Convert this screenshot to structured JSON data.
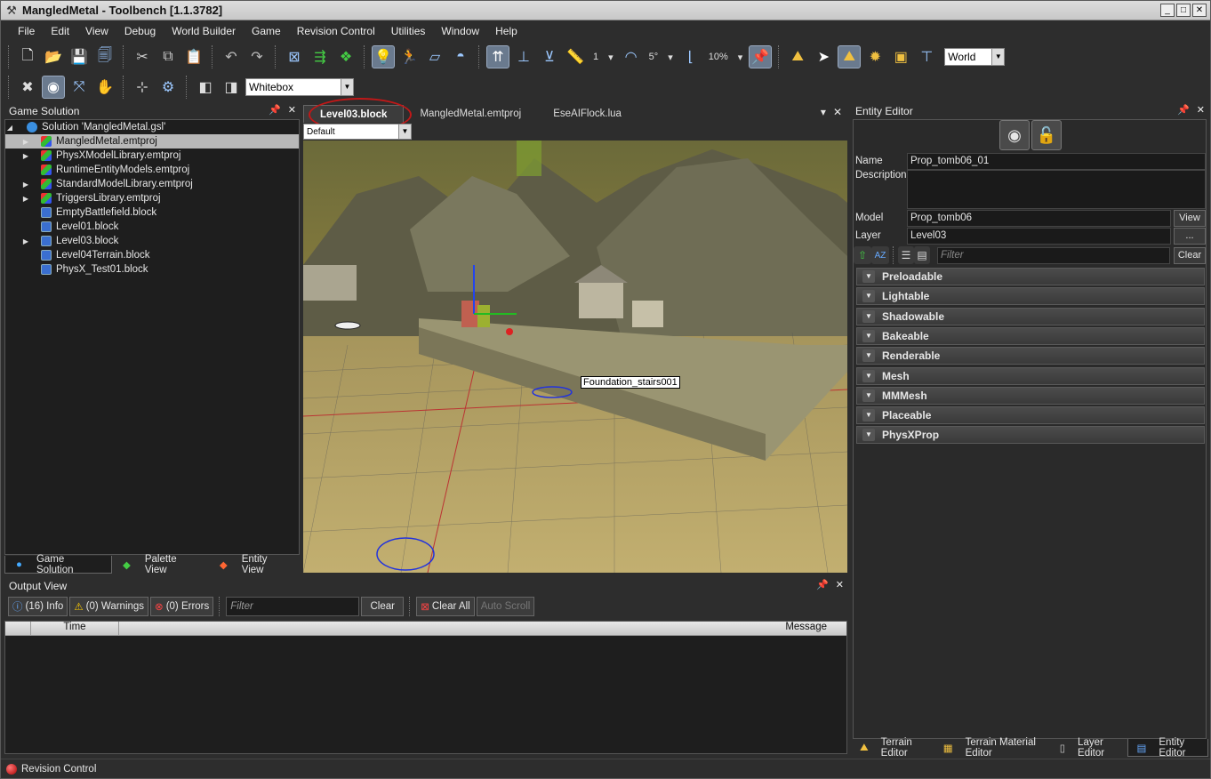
{
  "window": {
    "title": "MangledMetal - Toolbench [1.1.3782]"
  },
  "menu": [
    "File",
    "Edit",
    "View",
    "Debug",
    "World Builder",
    "Game",
    "Revision Control",
    "Utilities",
    "Window",
    "Help"
  ],
  "toolbar": {
    "snap_count": "1",
    "angle": "5°",
    "scale": "10%",
    "coord_space": "World",
    "render_mode": "Whitebox"
  },
  "solution": {
    "title": "Game Solution",
    "root": "Solution 'MangledMetal.gsl'",
    "items": [
      {
        "label": "MangledMetal.emtproj",
        "kind": "proj",
        "exp": true,
        "sel": true
      },
      {
        "label": "PhysXModelLibrary.emtproj",
        "kind": "proj",
        "exp": true
      },
      {
        "label": "RuntimeEntityModels.emtproj",
        "kind": "proj",
        "exp": false
      },
      {
        "label": "StandardModelLibrary.emtproj",
        "kind": "proj",
        "exp": true
      },
      {
        "label": "TriggersLibrary.emtproj",
        "kind": "proj",
        "exp": true
      },
      {
        "label": "EmptyBattlefield.block",
        "kind": "blk",
        "exp": false
      },
      {
        "label": "Level01.block",
        "kind": "blk",
        "exp": false
      },
      {
        "label": "Level03.block",
        "kind": "blk",
        "exp": true
      },
      {
        "label": "Level04Terrain.block",
        "kind": "blk",
        "exp": false
      },
      {
        "label": "PhysX_Test01.block",
        "kind": "blk",
        "exp": false
      }
    ],
    "tabs": [
      "Game Solution",
      "Palette View",
      "Entity View"
    ]
  },
  "doc": {
    "tabs": [
      "Level03.block",
      "MangledMetal.emtproj",
      "EseAIFlock.lua"
    ],
    "view_combo": "Default",
    "tooltip": "Foundation_stairs001"
  },
  "entity": {
    "title": "Entity Editor",
    "name_label": "Name",
    "name": "Prop_tomb06_01",
    "desc_label": "Description",
    "model_label": "Model",
    "model": "Prop_tomb06",
    "view_btn": "View",
    "layer_label": "Layer",
    "layer": "Level03",
    "more_btn": "...",
    "filter_placeholder": "Filter",
    "clear_btn": "Clear",
    "categories": [
      "Preloadable",
      "Lightable",
      "Shadowable",
      "Bakeable",
      "Renderable",
      "Mesh",
      "MMMesh",
      "Placeable",
      "PhysXProp"
    ],
    "tabs": [
      "Terrain Editor",
      "Terrain Material Editor",
      "Layer Editor",
      "Entity Editor"
    ]
  },
  "output": {
    "title": "Output View",
    "info": "(16) Info",
    "warnings": "(0) Warnings",
    "errors": "(0) Errors",
    "filter": "Filter",
    "clear": "Clear",
    "clear_all": "Clear All",
    "auto_scroll": "Auto Scroll",
    "col_time": "Time",
    "col_message": "Message"
  },
  "status": {
    "text": "Revision Control"
  }
}
